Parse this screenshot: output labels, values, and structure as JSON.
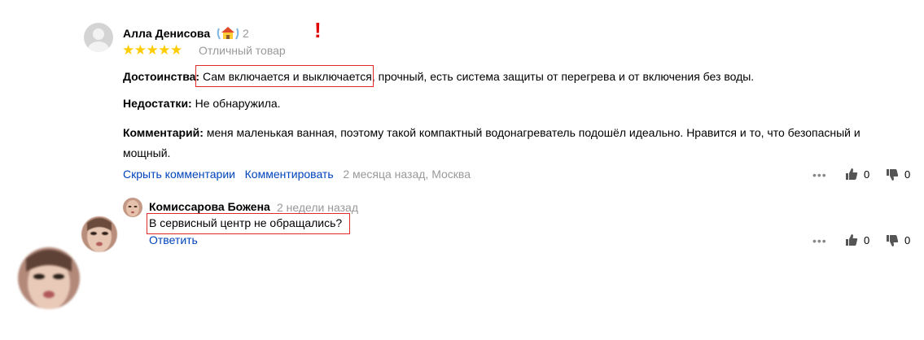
{
  "review": {
    "author": "Алла Денисова",
    "badge_count": "2",
    "stars": "★★★★★",
    "rating_label": "Отличный товар",
    "pros_label": "Достоинства:",
    "pros_highlight": "Сам включается и выключается,",
    "pros_rest": " прочный, есть система защиты от перегрева и от включения без воды.",
    "cons_label": "Недостатки:",
    "cons_text": " Не обнаружила.",
    "comment_label": "Комментарий:",
    "comment_text": " меня маленькая ванная, поэтому такой компактный водонагреватель подошёл идеально. Нравится и то, что безопасный и мощный.",
    "hide_comments": "Скрыть комментарии",
    "comment_action": "Комментировать",
    "meta": "2 месяца назад, Москва",
    "more": "•••",
    "likes": "0",
    "dislikes": "0"
  },
  "annotation": {
    "exclamation": "!"
  },
  "reply": {
    "author": "Комиссарова Божена",
    "time": "2 недели назад",
    "text": "В сервисный центр не обращались?",
    "answer": "Ответить",
    "more": "•••",
    "likes": "0",
    "dislikes": "0"
  },
  "colors": {
    "link": "#0044bb",
    "star": "#ffcc00",
    "muted": "#999999",
    "highlight_border": "#e02a2a"
  }
}
